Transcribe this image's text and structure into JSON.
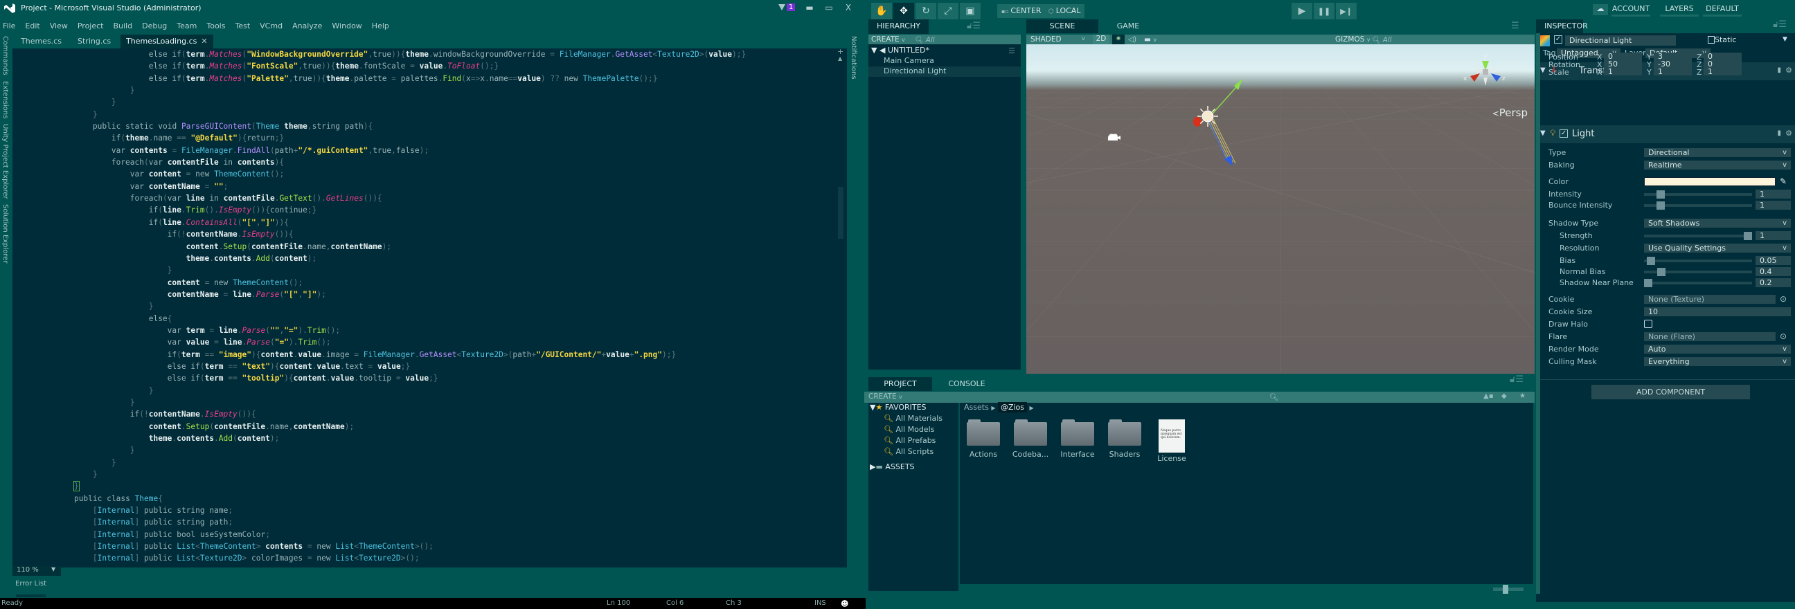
{
  "vs": {
    "window_title": "Project - Microsoft Visual Studio (Administrator)",
    "notification_count": "1",
    "window_controls": {
      "minimize": "▬",
      "maximize": "▭",
      "close": "X"
    },
    "menu": [
      "File",
      "Edit",
      "View",
      "Project",
      "Build",
      "Debug",
      "Team",
      "Tools",
      "Test",
      "VCmd",
      "Analyze",
      "Window",
      "Help"
    ],
    "left_rail": [
      "Commands",
      "Extensions",
      "Unity Project Explorer",
      "Solution Explorer"
    ],
    "right_rail": "Notifications",
    "tabs": [
      {
        "label": "Themes.cs",
        "active": false
      },
      {
        "label": "String.cs",
        "active": false
      },
      {
        "label": "ThemesLoading.cs",
        "active": true,
        "close": "✕"
      }
    ],
    "code_lines": [
      "                    else if(term.Matches(\"WindowBackgroundOverride\",true)){theme.windowBackgroundOverride = FileManager.GetAsset<Texture2D>(value);}",
      "                    else if(term.Matches(\"FontScale\",true)){theme.fontScale = value.ToFloat();}",
      "                    else if(term.Matches(\"Palette\",true)){theme.palette = palettes.Find(x=>x.name==value) ?? new ThemePalette();}",
      "                }",
      "            }",
      "        }",
      "        public static void ParseGUIContent(Theme theme,string path){",
      "            if(theme.name == \"@Default\"){return;}",
      "            var contents = FileManager.FindAll(path+\"/*.guiContent\",true,false);",
      "            foreach(var contentFile in contents){",
      "                var content = new ThemeContent();",
      "                var contentName = \"\";",
      "                foreach(var line in contentFile.GetText().GetLines()){",
      "                    if(line.Trim().IsEmpty()){continue;}",
      "                    if(line.ContainsAll(\"[\",\"]\")){",
      "                        if(!contentName.IsEmpty()){",
      "                            content.Setup(contentFile.name,contentName);",
      "                            theme.contents.Add(content);",
      "                        }",
      "                        content = new ThemeContent();",
      "                        contentName = line.Parse(\"[\",\"]\");",
      "                    }",
      "                    else{",
      "                        var term = line.Parse(\"\",\"=\").Trim();",
      "                        var value = line.Parse(\"=\").Trim();",
      "                        if(term == \"image\"){content.value.image = FileManager.GetAsset<Texture2D>(path+\"/GUIContent/\"+value+\".png\");}",
      "                        else if(term == \"text\"){content.value.text = value;}",
      "                        else if(term == \"tooltip\"){content.value.tooltip = value;}",
      "                    }",
      "                }",
      "                if(!contentName.IsEmpty()){",
      "                    content.Setup(contentFile.name,contentName);",
      "                    theme.contents.Add(content);",
      "                }",
      "            }",
      "        }",
      "    }",
      "    public class Theme{",
      "        [Internal] public string name;",
      "        [Internal] public string path;",
      "        [Internal] public bool useSystemColor;",
      "        [Internal] public List<ThemeContent> contents = new List<ThemeContent>();",
      "        [Internal] public List<Texture2D> colorImages = new List<Texture2D>();"
    ],
    "zoom_level": "110 %",
    "bottom_tab": "Error List",
    "status": {
      "state": "Ready",
      "line": "Ln 100",
      "col": "Col 6",
      "ch": "Ch 3",
      "mode": "INS"
    }
  },
  "unity": {
    "toolbar": {
      "tools": [
        {
          "name": "hand-tool",
          "glyph": "✋",
          "active": false
        },
        {
          "name": "move-tool",
          "glyph": "✥",
          "active": true
        },
        {
          "name": "rotate-tool",
          "glyph": "↻",
          "active": false
        },
        {
          "name": "scale-tool",
          "glyph": "⤢",
          "active": false
        },
        {
          "name": "rect-tool",
          "glyph": "▣",
          "active": false
        }
      ],
      "pivot": "CENTER",
      "space": "LOCAL",
      "play": "▶",
      "pause": "❚❚",
      "step": "▶❙",
      "cloud": "☁",
      "account": "ACCOUNT",
      "layers": "LAYERS",
      "layout": "DEFAULT"
    },
    "hierarchy": {
      "tab": "HIERARCHY",
      "create": "CREATE",
      "search_placeholder": "All",
      "scene_name": "UNTITLED*",
      "items": [
        "Main Camera",
        "Directional Light"
      ],
      "selected": "Directional Light"
    },
    "scene": {
      "tabs": [
        "SCENE",
        "GAME"
      ],
      "shading": "SHADED",
      "mode_2d": "2D",
      "gizmos": "GIZMOS",
      "search_placeholder": "All",
      "projection": "Persp",
      "axis_labels": {
        "x": "x",
        "y": "y",
        "z": "z"
      }
    },
    "inspector": {
      "tab": "INSPECTOR",
      "object_name": "Directional Light",
      "static_label": "Static",
      "tag_label": "Tag",
      "tag": "Untagged",
      "layer_label": "Layer",
      "layer": "Default",
      "transform": {
        "title": "Transform",
        "rows": [
          {
            "label": "Position",
            "x": "0",
            "y": "3",
            "z": "0"
          },
          {
            "label": "Rotation",
            "x": "50",
            "y": "-30",
            "z": "0"
          },
          {
            "label": "Scale",
            "x": "1",
            "y": "1",
            "z": "1"
          }
        ]
      },
      "light": {
        "title": "Light",
        "type_label": "Type",
        "type": "Directional",
        "baking_label": "Baking",
        "baking": "Realtime",
        "color_label": "Color",
        "color": "#fdf4dc",
        "intensity_label": "Intensity",
        "intensity": "1",
        "intensity_frac": 0.125,
        "bounce_label": "Bounce Intensity",
        "bounce": "1",
        "bounce_frac": 0.125,
        "shadow_type_label": "Shadow Type",
        "shadow_type": "Soft Shadows",
        "strength_label": "Strength",
        "strength": "1",
        "strength_frac": 1.0,
        "resolution_label": "Resolution",
        "resolution": "Use Quality Settings",
        "bias_label": "Bias",
        "bias": "0.05",
        "bias_frac": 0.025,
        "normal_bias_label": "Normal Bias",
        "normal_bias": "0.4",
        "normal_bias_frac": 0.13,
        "near_plane_label": "Shadow Near Plane",
        "near_plane": "0.2",
        "near_plane_frac": 0.0,
        "cookie_label": "Cookie",
        "cookie": "None (Texture)",
        "cookie_size_label": "Cookie Size",
        "cookie_size": "10",
        "draw_halo_label": "Draw Halo",
        "draw_halo": false,
        "flare_label": "Flare",
        "flare": "None (Flare)",
        "render_mode_label": "Render Mode",
        "render_mode": "Auto",
        "culling_mask_label": "Culling Mask",
        "culling_mask": "Everything"
      },
      "add_component": "ADD  COMPONENT"
    },
    "project": {
      "tabs": [
        "PROJECT",
        "CONSOLE"
      ],
      "create": "CREATE",
      "favorites_label": "FAVORITES",
      "favorites": [
        "All Materials",
        "All Models",
        "All Prefabs",
        "All Scripts"
      ],
      "assets_label": "ASSETS",
      "breadcrumb": [
        "Assets",
        "@Zios"
      ],
      "items": [
        {
          "name": "Actions",
          "kind": "folder"
        },
        {
          "name": "Codeba...",
          "kind": "folder"
        },
        {
          "name": "Interface",
          "kind": "folder"
        },
        {
          "name": "Shaders",
          "kind": "folder"
        },
        {
          "name": "License",
          "kind": "document",
          "preview": "Neque porro quisquam est qui dolorem."
        }
      ]
    }
  }
}
